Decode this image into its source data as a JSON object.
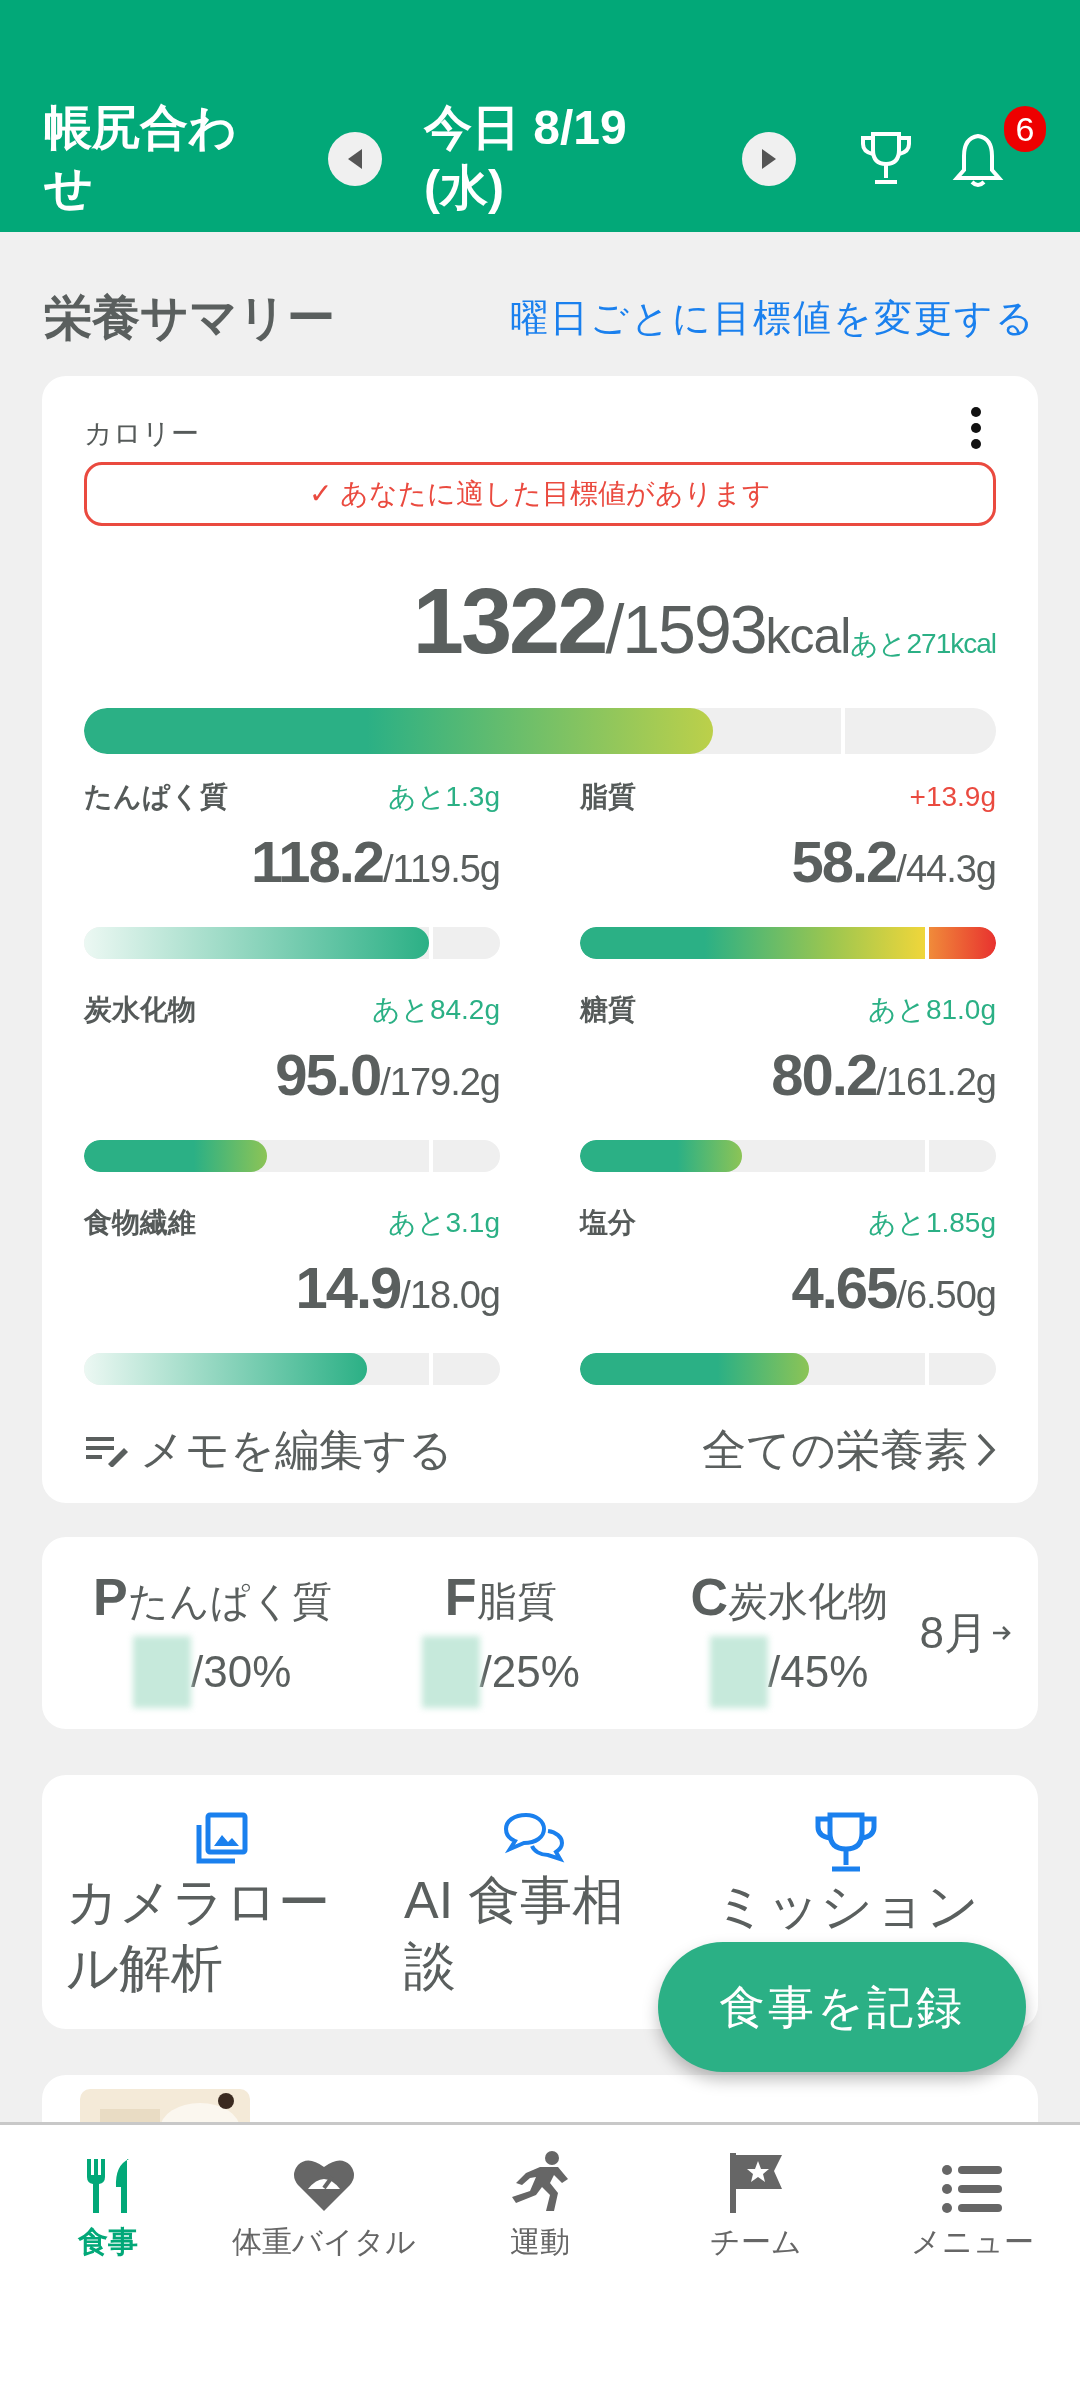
{
  "header": {
    "title": "帳尻合わせ",
    "date": "今日 8/19 (水)",
    "notification_count": "6"
  },
  "summary": {
    "title": "栄養サマリー",
    "link": "曜日ごとに目標値を変更する"
  },
  "calorie": {
    "label": "カロリー",
    "notice": "✓ あなたに適した目標値があります",
    "intake": "1322",
    "target": "/1593",
    "unit": "kcal",
    "remaining": "あと271kcal",
    "level": 0.69
  },
  "nutrients": [
    {
      "name": "たんぱく質",
      "remaining": "あと1.3g",
      "over": false,
      "intake": "118.2",
      "target": "/119.5g",
      "level": 0.83,
      "kind": "fade"
    },
    {
      "name": "脂質",
      "remaining": "+13.9g",
      "over": true,
      "intake": "58.2",
      "target": "/44.3g",
      "level": 1,
      "kind": "warm"
    },
    {
      "name": "炭水化物",
      "remaining": "あと84.2g",
      "over": false,
      "intake": "95.0",
      "target": "/179.2g",
      "level": 0.44,
      "kind": "solid"
    },
    {
      "name": "糖質",
      "remaining": "あと81.0g",
      "over": false,
      "intake": "80.2",
      "target": "/161.2g",
      "level": 0.39,
      "kind": "solid"
    },
    {
      "name": "食物繊維",
      "remaining": "あと3.1g",
      "over": false,
      "intake": "14.9",
      "target": "/18.0g",
      "level": 0.68,
      "kind": "fade"
    },
    {
      "name": "塩分",
      "remaining": "あと1.85g",
      "over": false,
      "intake": "4.65",
      "target": "/6.50g",
      "level": 0.55,
      "kind": "solid"
    }
  ],
  "memo": "メモを編集する",
  "all_nutrients": "全ての栄養素",
  "pfc": {
    "items": [
      {
        "letter": "P",
        "label": "たんぱく質",
        "target": "/30%"
      },
      {
        "letter": "F",
        "label": "脂質",
        "target": "/25%"
      },
      {
        "letter": "C",
        "label": "炭水化物",
        "target": "/45%"
      }
    ],
    "month": "8月"
  },
  "shortcuts": [
    {
      "kind": "gallery",
      "label": "カメラロール解析"
    },
    {
      "kind": "chat",
      "label": "AI 食事相談"
    },
    {
      "kind": "trophy",
      "label": "ミッション"
    }
  ],
  "fab": "食事を記録",
  "nav": [
    {
      "kind": "meal",
      "label": "食事",
      "selected": true
    },
    {
      "kind": "vital",
      "label": "体重バイタル",
      "selected": false
    },
    {
      "kind": "exercise",
      "label": "運動",
      "selected": false
    },
    {
      "kind": "team",
      "label": "チーム",
      "selected": false
    },
    {
      "kind": "menu",
      "label": "メニュー",
      "selected": false
    }
  ]
}
